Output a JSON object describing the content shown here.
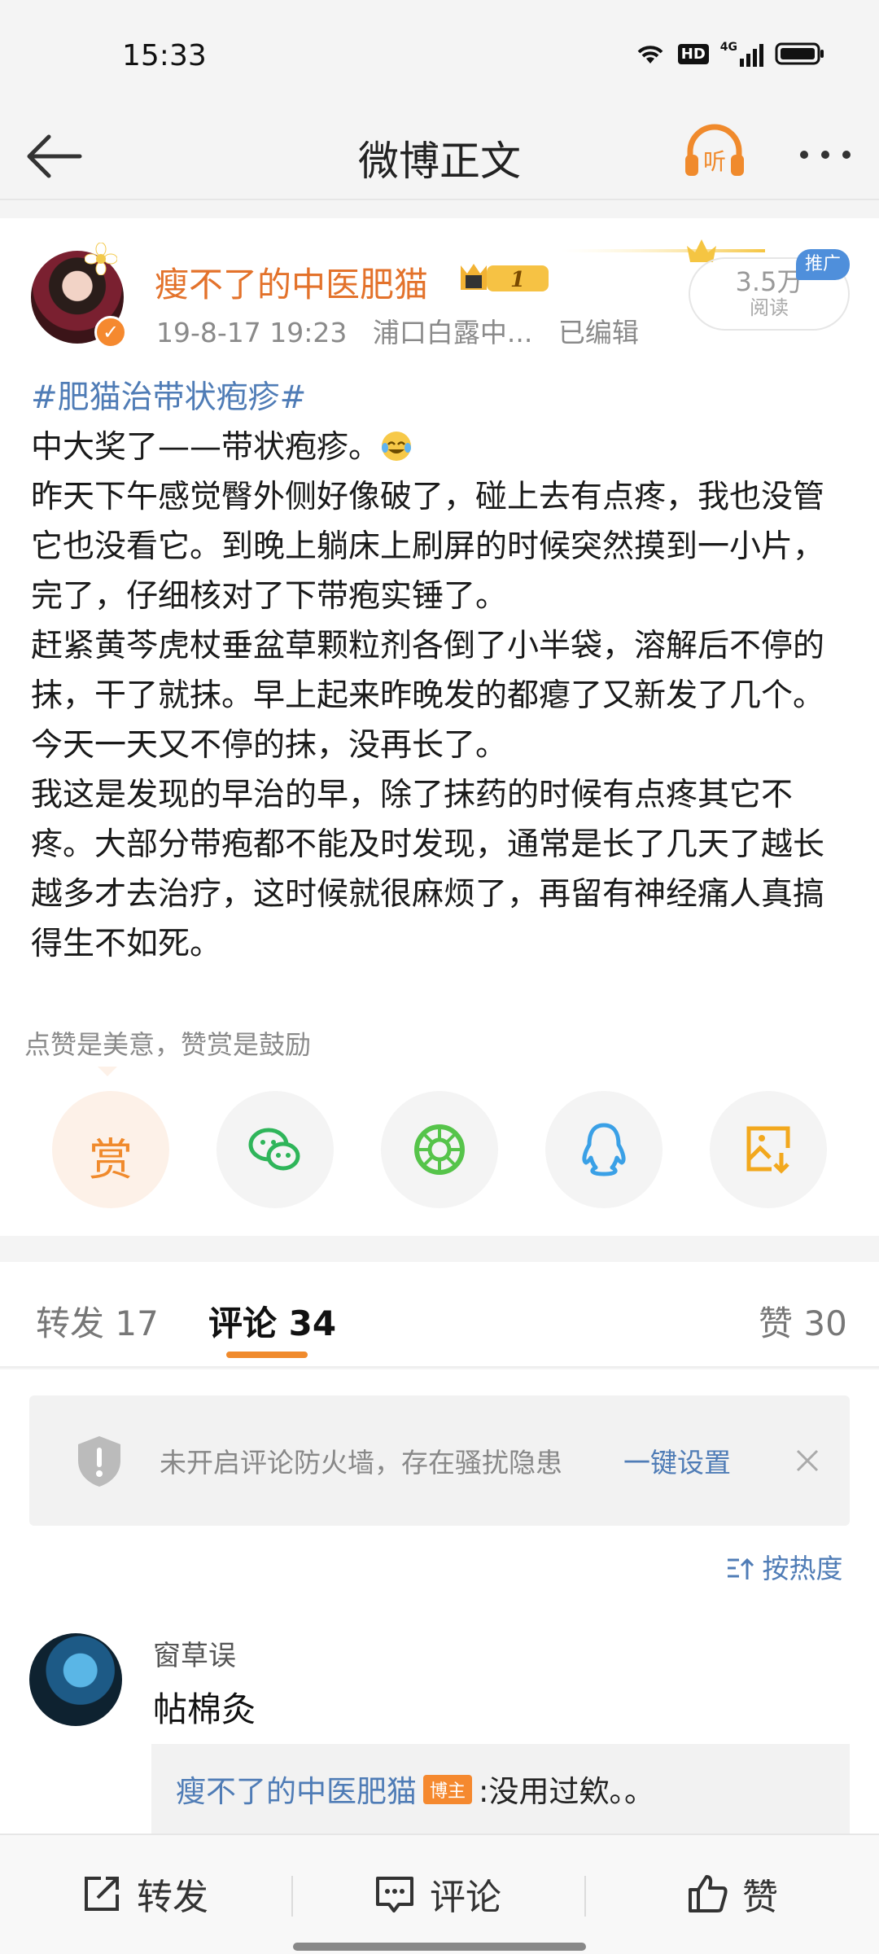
{
  "status_bar": {
    "time": "15:33",
    "network": "4G",
    "hd": "HD"
  },
  "nav": {
    "title": "微博正文",
    "listen_label": "听"
  },
  "post": {
    "author": "瘦不了的中医肥猫",
    "vip_level": "1",
    "time": "19-8-17 19:23",
    "location": "浦口白露中...",
    "edited": "已编辑",
    "reads": "3.5万",
    "reads_label": "阅读",
    "promo": "推广",
    "hashtag": "#肥猫治带状疱疹#",
    "paragraphs": [
      "中大奖了——带状疱疹。",
      "昨天下午感觉臀外侧好像破了，碰上去有点疼，我也没管它也没看它。到晚上躺床上刷屏的时候突然摸到一小片，完了，仔细核对了下带疱实锤了。",
      "赶紧黄芩虎杖垂盆草颗粒剂各倒了小半袋，溶解后不停的抹，干了就抹。早上起来昨晚发的都瘪了又新发了几个。今天一天又不停的抹，没再长了。",
      "我这是发现的早治的早，除了抹药的时候有点疼其它不疼。大部分带疱都不能及时发现，通常是长了几天了越长越多才去治疗，这时候就很麻烦了，再留有神经痛人真搞得生不如死。"
    ],
    "reward_tip": "点赞是美意，赞赏是鼓励",
    "reward_label": "赏",
    "share_icons": [
      "wechat-icon",
      "moments-icon",
      "qq-icon",
      "save-image-icon"
    ]
  },
  "tabs": {
    "repost": "转发 17",
    "comment": "评论 34",
    "like": "赞 30"
  },
  "firewall": {
    "text": "未开启评论防火墙，存在骚扰隐患",
    "link": "一键设置"
  },
  "sort_label": "按热度",
  "comment": {
    "name": "窗草误",
    "text": "帖棉灸",
    "reply_author": "瘦不了的中医肥猫",
    "reply_tag": "博主",
    "reply_text": ":没用过欸。。"
  },
  "bottom_bar": {
    "repost": "转发",
    "comment": "评论",
    "like": "赞"
  },
  "colors": {
    "accent": "#f08a2c",
    "link": "#4f7cb6",
    "author": "#e3722b"
  }
}
